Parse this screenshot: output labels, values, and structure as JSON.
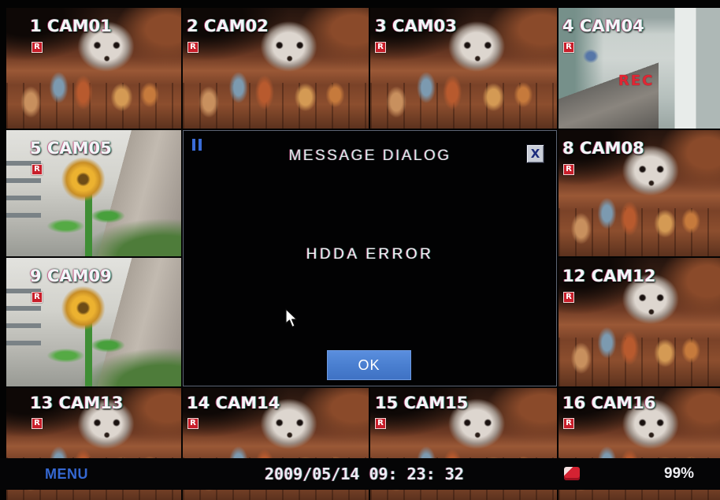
{
  "cameras": [
    {
      "label": "1 CAM01",
      "badge": "R"
    },
    {
      "label": "2 CAM02",
      "badge": "R"
    },
    {
      "label": "3 CAM03",
      "badge": "R"
    },
    {
      "label": "4 CAM04",
      "badge": "R",
      "overlay": "REC"
    },
    {
      "label": "5 CAM05",
      "badge": "R"
    },
    {
      "label": "8 CAM08",
      "badge": "R"
    },
    {
      "label": "9 CAM09",
      "badge": "R"
    },
    {
      "label": "12 CAM12",
      "badge": "R"
    },
    {
      "label": "13 CAM13",
      "badge": "R"
    },
    {
      "label": "14 CAM14",
      "badge": "R"
    },
    {
      "label": "15 CAM15",
      "badge": "R"
    },
    {
      "label": "16 CAM16",
      "badge": "R"
    }
  ],
  "dialog": {
    "title": "MESSAGE DIALOG",
    "close_label": "X",
    "message": "HDDA ERROR",
    "ok_label": "OK",
    "icons": {
      "handle": "pause-icon",
      "cursor": "mouse-cursor-icon"
    }
  },
  "status_bar": {
    "menu_label": "MENU",
    "datetime": "2009/05/14 09: 23: 32",
    "hdd_icon": "hdd-icon",
    "hdd_usage": "99%"
  },
  "colors": {
    "accent": "#3568d2",
    "record_badge": "#c81e2a",
    "rec_text": "#e02634",
    "ok_button": "#4a7fd0"
  }
}
